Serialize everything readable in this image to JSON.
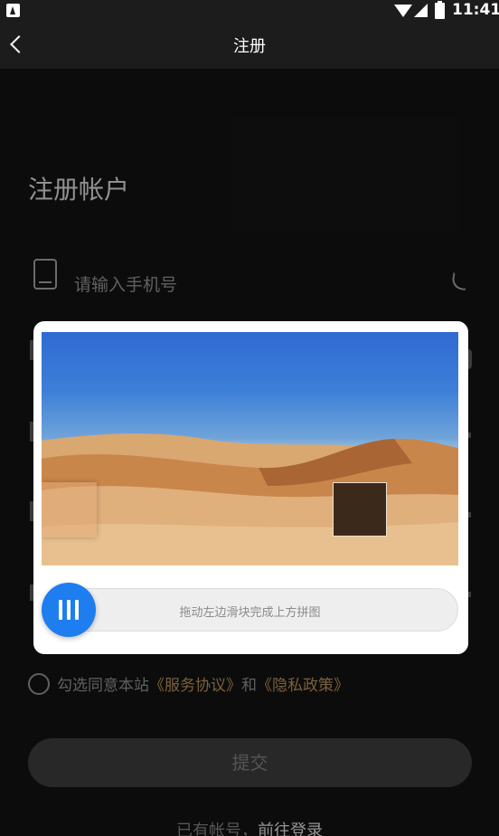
{
  "status_bar": {
    "time": "11:41",
    "icons": [
      "app-notification-icon",
      "wifi-icon",
      "signal-icon",
      "battery-charging-icon"
    ]
  },
  "header": {
    "title": "注册",
    "back_icon": "chevron-left-icon"
  },
  "form": {
    "heading": "注册帐户",
    "phone_placeholder": "请输入手机号",
    "agree_prefix": "勾选同意本站",
    "agree_service": "《服务协议》",
    "agree_and": "和",
    "agree_privacy": "《隐私政策》",
    "submit_label": "提交",
    "login_prefix": "已有帐号，",
    "login_link": "前往登录"
  },
  "captcha": {
    "instruction": "拖动左边滑块完成上方拼图",
    "handle_icon": "grip-bars-icon",
    "accent": "#1e7ef0"
  },
  "colors": {
    "background": "#121212",
    "header": "#1c1c1c",
    "link": "#b08a55"
  }
}
